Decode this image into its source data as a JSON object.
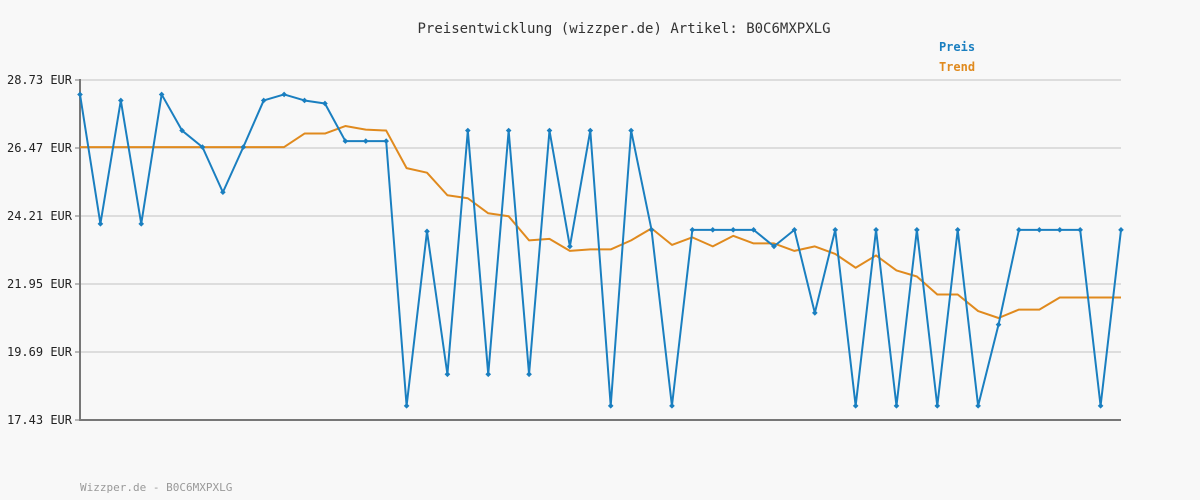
{
  "chart_data": {
    "type": "line",
    "title": "Preisentwicklung (wizzper.de) Artikel: B0C6MXPXLG",
    "xlabel": "",
    "ylabel": "",
    "ylim": [
      17.43,
      28.73
    ],
    "yticks": [
      "28.73 EUR",
      "26.47 EUR",
      "24.21 EUR",
      "21.95 EUR",
      "19.69 EUR",
      "17.43 EUR"
    ],
    "ytick_values": [
      28.73,
      26.47,
      24.21,
      21.95,
      19.69,
      17.43
    ],
    "grid": true,
    "legend_position": "top-right",
    "series": [
      {
        "name": "Preis",
        "color": "#1a7fc0",
        "values": [
          28.25,
          23.95,
          28.05,
          23.95,
          28.25,
          27.05,
          26.5,
          25.0,
          26.5,
          28.05,
          28.25,
          28.05,
          27.95,
          26.7,
          26.7,
          26.7,
          17.9,
          23.7,
          18.95,
          27.05,
          18.95,
          27.05,
          18.95,
          27.05,
          23.2,
          27.05,
          17.9,
          27.05,
          23.75,
          17.9,
          23.75,
          23.75,
          23.75,
          23.75,
          23.2,
          23.75,
          20.99,
          23.75,
          17.9,
          23.75,
          17.9,
          23.75,
          17.9,
          23.75,
          17.9,
          20.6,
          23.75,
          23.75,
          23.75,
          23.75,
          17.9,
          23.75
        ]
      },
      {
        "name": "Trend",
        "color": "#e08a1e",
        "values": [
          26.5,
          26.5,
          26.5,
          26.5,
          26.5,
          26.5,
          26.5,
          26.5,
          26.5,
          26.5,
          26.5,
          26.95,
          26.95,
          27.2,
          27.08,
          27.05,
          25.8,
          25.65,
          24.9,
          24.8,
          24.3,
          24.2,
          23.4,
          23.45,
          23.05,
          23.1,
          23.1,
          23.4,
          23.8,
          23.25,
          23.5,
          23.2,
          23.55,
          23.3,
          23.3,
          23.05,
          23.2,
          22.95,
          22.49,
          22.9,
          22.4,
          22.2,
          21.6,
          21.6,
          21.05,
          20.82,
          21.1,
          21.1,
          21.5,
          21.5,
          21.5,
          21.5
        ]
      }
    ]
  },
  "footer": {
    "text": "Wizzper.de - B0C6MXPXLG"
  }
}
